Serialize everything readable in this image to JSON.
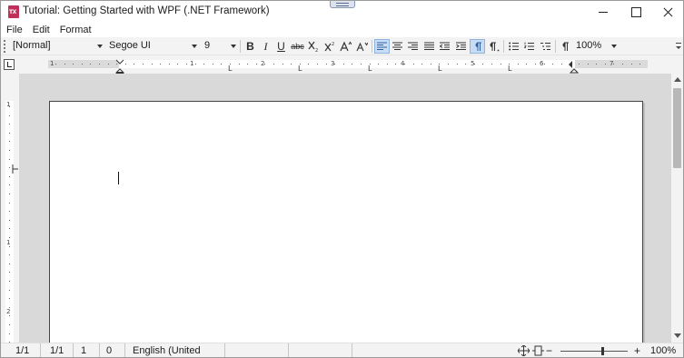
{
  "window": {
    "title": "Tutorial: Getting Started with WPF (.NET Framework)",
    "app_icon_text": "TX"
  },
  "menu": {
    "items": [
      {
        "label": "File"
      },
      {
        "label": "Edit"
      },
      {
        "label": "Format"
      }
    ]
  },
  "toolbar": {
    "style_value": "[Normal]",
    "font_value": "Segoe UI",
    "size_value": "9",
    "bold": "B",
    "italic": "I",
    "underline": "U",
    "strikethrough": "abc",
    "zoom_value": "100%",
    "active_button": "show-paragraph-marks"
  },
  "ruler": {
    "numbers": [
      "1",
      "1",
      "2",
      "3",
      "4",
      "5",
      "6",
      "7"
    ],
    "v_numbers": [
      "1",
      "1",
      "2"
    ]
  },
  "statusbar": {
    "page": "1/1",
    "section": "1/1",
    "line": "1",
    "column": "0",
    "language": "English (United States)",
    "zoom": "100%",
    "zoom_level_percent": 100
  },
  "colors": {
    "accent": "#c0305a",
    "active_button_bg": "#c7dcf5",
    "workspace_bg": "#d9d9d9"
  }
}
